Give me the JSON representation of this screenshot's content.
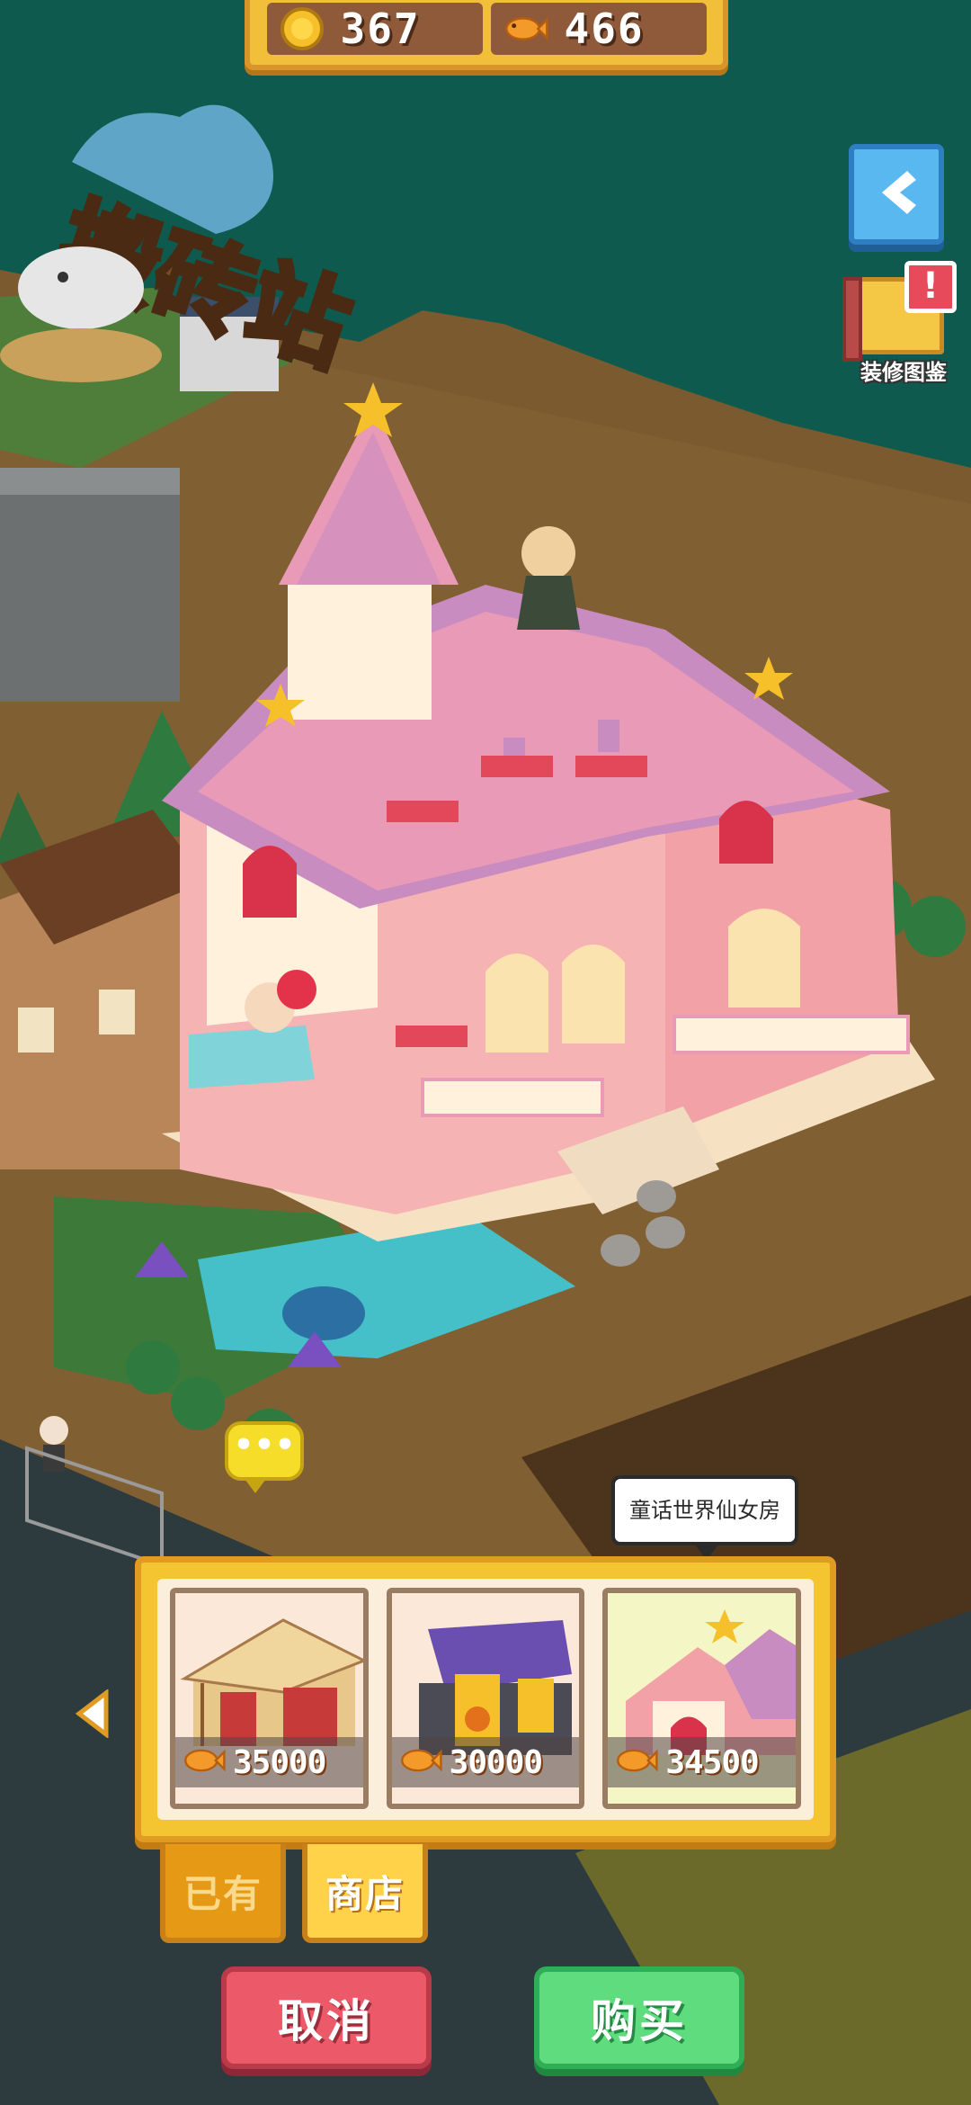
{
  "currency": {
    "coins": "367",
    "fish": "466"
  },
  "side": {
    "catalog_label": "装修图鉴",
    "catalog_alert": "!"
  },
  "scene": {
    "station_sign": "搬砖站",
    "chat_dots": "•••"
  },
  "tooltip": {
    "text": "童话世界仙女房"
  },
  "shop": {
    "items": [
      {
        "name": "wooden-house",
        "price": "35000",
        "selected": false
      },
      {
        "name": "haunted-house",
        "price": "30000",
        "selected": false
      },
      {
        "name": "fairy-house",
        "price": "34500",
        "selected": true
      }
    ]
  },
  "tabs": {
    "owned": "已有",
    "shop": "商店"
  },
  "buttons": {
    "cancel": "取消",
    "buy": "购买"
  },
  "colors": {
    "background_sea": "#0f5a4e",
    "ground": "#7a5a2e",
    "house_pink": "#f2a1a6",
    "roof_scales": "#c98cc0",
    "panel_gold": "#f5c431",
    "cancel_red": "#ec5a6a",
    "buy_green": "#5fdc7e"
  }
}
